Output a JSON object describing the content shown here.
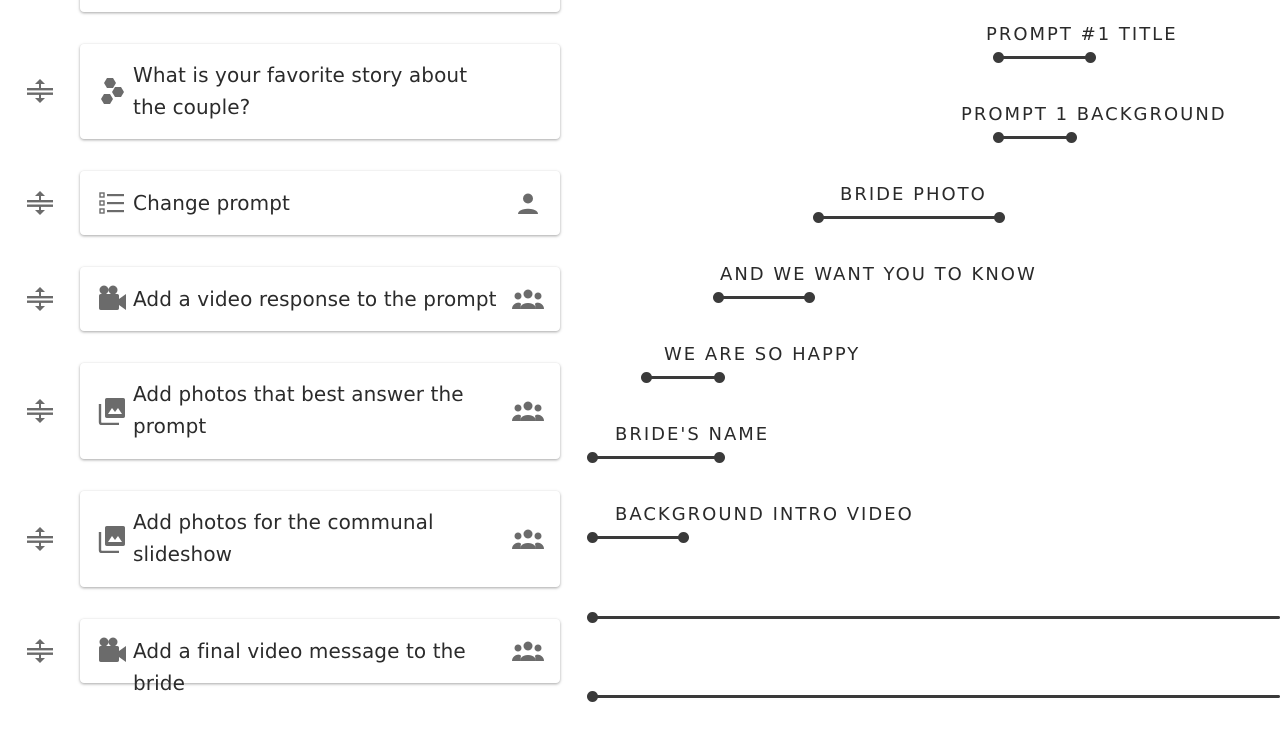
{
  "steps": [
    {
      "label": "",
      "lead_icon": "",
      "trail_icon": ""
    },
    {
      "label": "What is your favorite story about the couple?",
      "lead_icon": "hexagon-cluster-icon",
      "trail_icon": ""
    },
    {
      "label": "Change prompt",
      "lead_icon": "checklist-icon",
      "trail_icon": "person-icon"
    },
    {
      "label": "Add a video response to the prompt",
      "lead_icon": "video-camera-icon",
      "trail_icon": "group-icon"
    },
    {
      "label": "Add photos that best answer the prompt",
      "lead_icon": "photo-library-icon",
      "trail_icon": "group-icon"
    },
    {
      "label": "Add photos for the communal slideshow",
      "lead_icon": "photo-library-icon",
      "trail_icon": "group-icon"
    },
    {
      "label": "Add a final video message to the bride",
      "lead_icon": "video-camera-icon",
      "trail_icon": "group-icon"
    }
  ],
  "timeline": [
    {
      "label": "PROMPT #1 TITLE"
    },
    {
      "label": "PROMPT 1 BACKGROUND"
    },
    {
      "label": "BRIDE PHOTO"
    },
    {
      "label": "AND WE WANT YOU TO KNOW"
    },
    {
      "label": "WE ARE SO HAPPY"
    },
    {
      "label": "BRIDE'S NAME"
    },
    {
      "label": "BACKGROUND INTRO VIDEO"
    },
    {
      "label": ""
    },
    {
      "label": ""
    }
  ],
  "colors": {
    "icon": "#6b6b6b",
    "track": "#3a3a3a"
  }
}
